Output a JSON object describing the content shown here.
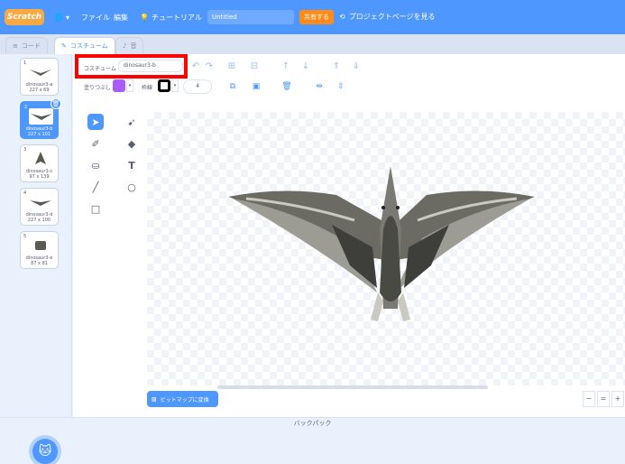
{
  "menubar": {
    "logo": "Scratch",
    "language_icon": "globe-icon",
    "file": "ファイル",
    "edit": "編集",
    "tutorial": "チュートリアル",
    "project_title": "Untitled",
    "share": "共有する",
    "project_page": "プロジェクトページを見る"
  },
  "tabs": {
    "code": "コード",
    "costumes": "コスチューム",
    "sounds": "音"
  },
  "costumes": [
    {
      "num": "1",
      "name": "dinosaur3-a",
      "size": "227 x 69"
    },
    {
      "num": "2",
      "name": "dinosaur3-b",
      "size": "227 x 101"
    },
    {
      "num": "3",
      "name": "dinosaur3-c",
      "size": "97 x 139"
    },
    {
      "num": "4",
      "name": "dinosaur3-d",
      "size": "227 x 100"
    },
    {
      "num": "5",
      "name": "dinosaur3-e",
      "size": "87 x 81"
    }
  ],
  "editor": {
    "costume_label": "コスチューム",
    "costume_name": "dinosaur3-b",
    "fill_label": "塗りつぶし",
    "outline_label": "枠線",
    "outline_width": "4",
    "fill_color": "#a65cff",
    "outline_color": "#000000",
    "convert_bitmap": "ビットマップに変換",
    "zoom_out": "−",
    "zoom_reset": "=",
    "zoom_in": "+"
  },
  "backpack": "バックパック",
  "colors": {
    "accent": "#4d97ff",
    "highlight": "#ff0000",
    "share": "#ff8c1a"
  }
}
